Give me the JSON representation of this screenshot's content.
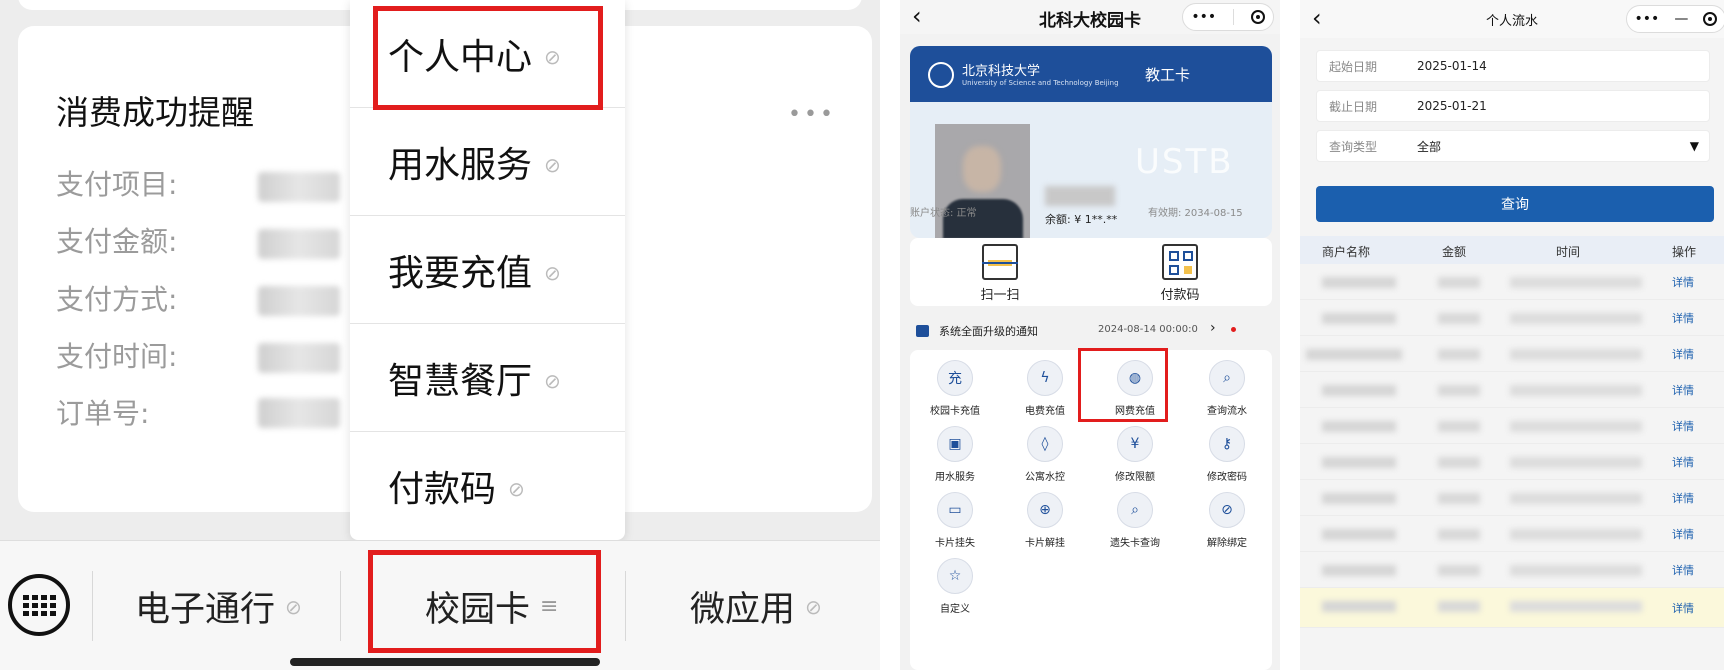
{
  "panel1": {
    "message": {
      "title": "消费成功提醒",
      "more": "•••",
      "fields": [
        {
          "label": "支付项目:"
        },
        {
          "label": "支付金额:"
        },
        {
          "label": "支付方式:"
        },
        {
          "label": "支付时间:"
        },
        {
          "label": "订单号:"
        }
      ]
    },
    "menu": {
      "items": [
        "个人中心",
        "用水服务",
        "我要充值",
        "智慧餐厅",
        "付款码"
      ]
    },
    "bottom_bar": {
      "items": [
        "电子通行",
        "校园卡",
        "微应用"
      ],
      "menu_glyph": "≡"
    }
  },
  "panel2": {
    "nav": {
      "title": "北科大校园卡",
      "back": "‹",
      "more": "•••"
    },
    "card": {
      "university": "北京科技大学",
      "university_en": "University of Science and Technology Beijing",
      "type": "教工卡",
      "watermark": "USTB",
      "balance_label": "余额: ¥ 1**.**",
      "status": "账户状态: 正常",
      "valid": "有效期: 2034-08-15"
    },
    "quick": [
      "扫一扫",
      "付款码"
    ],
    "notice": {
      "text": "系统全面升级的通知",
      "date": "2024-08-14 00:00:0",
      "arrow": "›"
    },
    "services": [
      {
        "label": "校园卡充值",
        "glyph": "充",
        "icon": "recharge-icon"
      },
      {
        "label": "电费充值",
        "glyph": "ϟ",
        "icon": "lightning-icon"
      },
      {
        "label": "网费充值",
        "glyph": "◍",
        "icon": "globe-icon"
      },
      {
        "label": "查询流水",
        "glyph": "⌕",
        "icon": "card-search-icon"
      },
      {
        "label": "用水服务",
        "glyph": "▣",
        "icon": "water-meter-icon"
      },
      {
        "label": "公寓水控",
        "glyph": "◊",
        "icon": "water-drop-icon"
      },
      {
        "label": "修改限额",
        "glyph": "¥",
        "icon": "limit-edit-icon"
      },
      {
        "label": "修改密码",
        "glyph": "⚷",
        "icon": "key-icon"
      },
      {
        "label": "卡片挂失",
        "glyph": "▭",
        "icon": "card-lost-icon"
      },
      {
        "label": "卡片解挂",
        "glyph": "⊕",
        "icon": "card-unlock-icon"
      },
      {
        "label": "遗失卡查询",
        "glyph": "⌕",
        "icon": "lost-card-search-icon"
      },
      {
        "label": "解除绑定",
        "glyph": "⊘",
        "icon": "unbind-icon"
      },
      {
        "label": "自定义",
        "glyph": "☆",
        "icon": "custom-icon"
      }
    ]
  },
  "panel3": {
    "nav": {
      "title": "个人流水",
      "back": "‹",
      "more": "•••",
      "minus": "—"
    },
    "filters": [
      {
        "label": "起始日期",
        "value": "2025-01-14"
      },
      {
        "label": "截止日期",
        "value": "2025-01-21"
      },
      {
        "label": "查询类型",
        "value": "全部"
      }
    ],
    "dropdown_arrow": "▼",
    "query_button": "查询",
    "columns": [
      "商户名称",
      "金额",
      "时间",
      "操作"
    ],
    "rows": [
      "详情",
      "详情",
      "详情",
      "详情",
      "详情",
      "详情",
      "详情",
      "详情",
      "详情",
      "详情"
    ]
  }
}
